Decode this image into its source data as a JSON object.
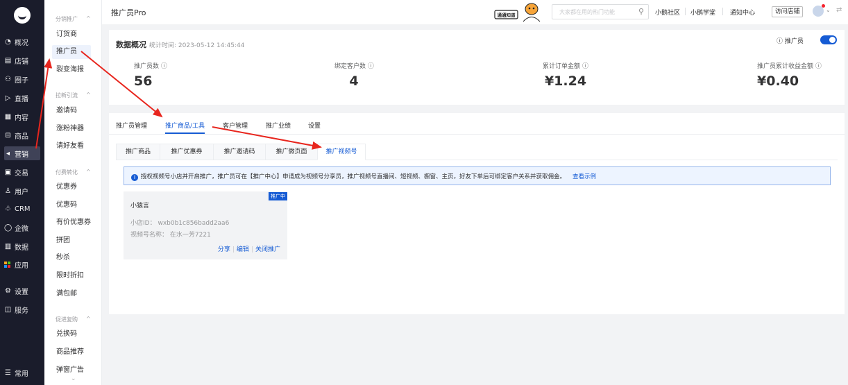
{
  "nav_primary": {
    "items": [
      {
        "icon": "◔",
        "label": "概况"
      },
      {
        "icon": "▤",
        "label": "店铺"
      },
      {
        "icon": "⚇",
        "label": "圈子"
      },
      {
        "icon": "▷",
        "label": "直播"
      },
      {
        "icon": "▦",
        "label": "内容"
      },
      {
        "icon": "⊟",
        "label": "商品"
      },
      {
        "icon": "◂",
        "label": "营销"
      },
      {
        "icon": "▣",
        "label": "交易"
      },
      {
        "icon": "♙",
        "label": "用户"
      },
      {
        "icon": "♧",
        "label": "CRM"
      },
      {
        "icon": "◯",
        "label": "企微"
      },
      {
        "icon": "▥",
        "label": "数据"
      },
      {
        "icon": "",
        "label": "应用"
      },
      {
        "icon": "⚙",
        "label": "设置"
      },
      {
        "icon": "◫",
        "label": "服务"
      }
    ],
    "bottom": {
      "icon": "☰",
      "label": "常用"
    },
    "app_colors": [
      "#f5a623",
      "#52c41a",
      "#1890ff",
      "#f5222d"
    ]
  },
  "nav_secondary": {
    "groups": [
      {
        "title": "分销推广",
        "items": [
          "订货商",
          "推广员",
          "裂变海报"
        ]
      },
      {
        "title": "拉新引流",
        "items": [
          "邀请码",
          "涨粉神器",
          "请好友看"
        ]
      },
      {
        "title": "付费转化",
        "items": [
          "优惠券",
          "优惠码",
          "有价优惠券",
          "拼团",
          "秒杀",
          "限时折扣",
          "满包邮"
        ]
      },
      {
        "title": "促进复购",
        "items": [
          "兑换码",
          "商品推荐",
          "弹窗广告"
        ]
      }
    ]
  },
  "header": {
    "page_title": "推广员Pro",
    "mascot_text": "通通知道",
    "search_placeholder": "大家都在用的热门功能",
    "links": [
      "小鹅社区",
      "小鹅学堂",
      "通知中心"
    ],
    "visit_button": "访问店铺"
  },
  "overview": {
    "title": "数据概况",
    "stat_time": "统计时间: 2023-05-12 14:45:44",
    "toggle_label": "推广员",
    "toggle_on": true,
    "stats": [
      {
        "label": "推广员数",
        "value": "56"
      },
      {
        "label": "绑定客户数",
        "value": "4"
      },
      {
        "label": "累计订单金额",
        "value": "¥1.24"
      },
      {
        "label": "推广员累计收益金额",
        "value": "¥0.40"
      }
    ]
  },
  "tabs": [
    "推广员管理",
    "推广商品/工具",
    "客户管理",
    "推广业绩",
    "设置"
  ],
  "subtabs": [
    "推广商品",
    "推广优惠券",
    "推广邀请码",
    "推广微页面",
    "推广视频号"
  ],
  "notice": {
    "text": "授权视频号小店并开启推广，推广员可在【推广中心】申请成为视频号分享员，推广视频号直播间、短视频、橱窗、主页，好友下单后可绑定客户关系并获取佣金。",
    "link": "查看示例"
  },
  "channel_card": {
    "badge": "推广中",
    "name": "小猿言",
    "shop_id_label": "小店ID：",
    "shop_id": "wxb0b1c856badd2aa6",
    "channel_label": "视频号名称：",
    "channel_name": "在水一芳7221",
    "actions": [
      "分享",
      "编辑",
      "关闭推广"
    ]
  }
}
